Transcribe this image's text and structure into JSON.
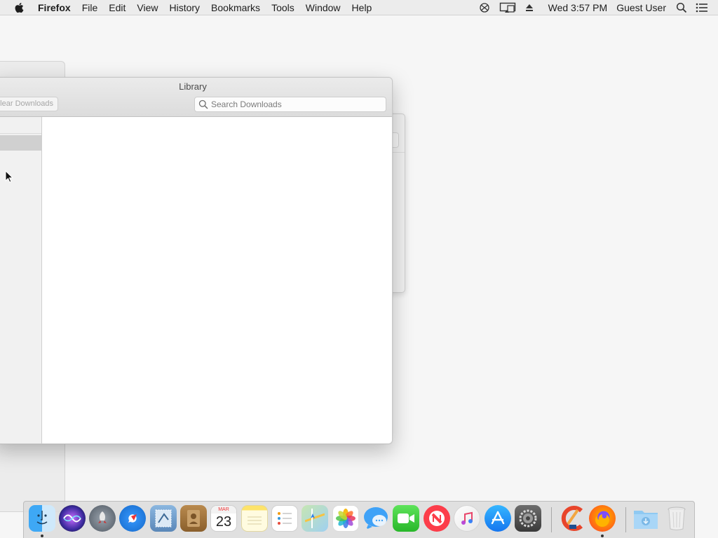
{
  "menubar": {
    "app_name": "Firefox",
    "items": [
      "File",
      "Edit",
      "View",
      "History",
      "Bookmarks",
      "Tools",
      "Window",
      "Help"
    ],
    "clock": "Wed 3:57 PM",
    "user": "Guest User"
  },
  "library": {
    "title": "Library",
    "clear_downloads_label": "lear Downloads",
    "search_placeholder": "Search Downloads"
  },
  "dock": {
    "calendar_month": "MAR",
    "calendar_day": "23"
  },
  "colors": {
    "menubar_bg": "#ececec",
    "desktop_bg": "#f6f6f6",
    "sidebar_selected": "#d0d0d0"
  }
}
